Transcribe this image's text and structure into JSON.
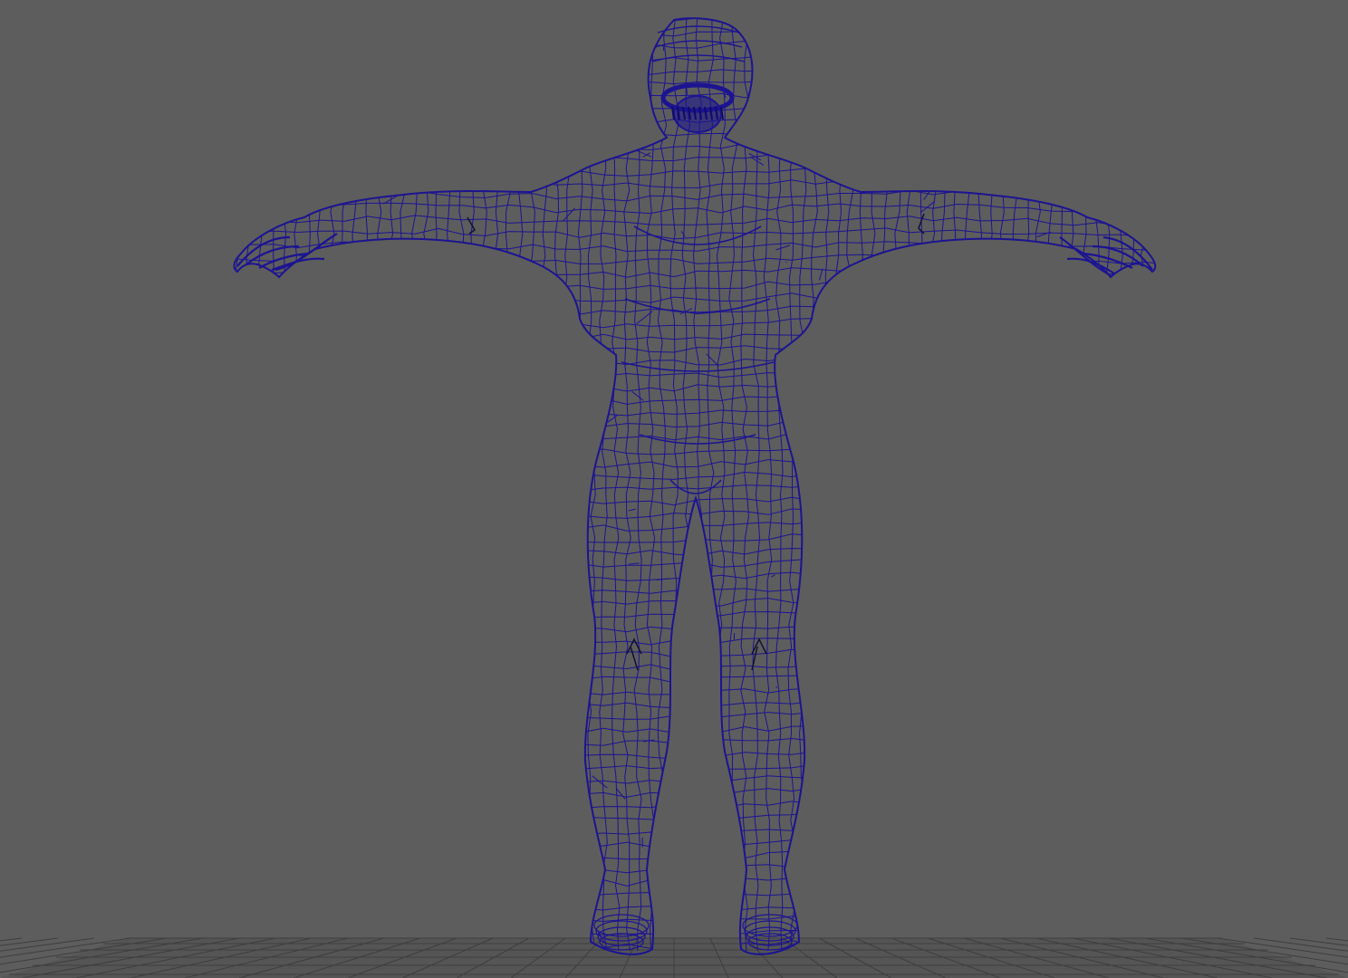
{
  "viewport": {
    "background_color": "#5d5d5d",
    "display_mode": "wireframe",
    "view": "front"
  },
  "scene": {
    "model": {
      "type": "humanoid-character-mesh",
      "pose": "t-pose",
      "wire_color": "#1c1490"
    },
    "ground_grid": {
      "visible": true,
      "line_color": "#3e3e3e"
    }
  }
}
